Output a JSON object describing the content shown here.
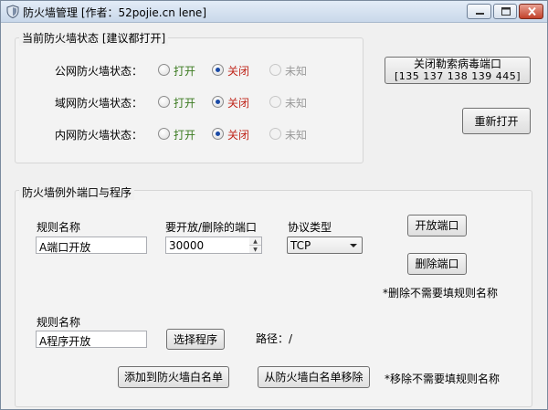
{
  "window": {
    "title": "防火墙管理 [作者：52pojie.cn lene]",
    "controls": {
      "minimize": "minimize",
      "maximize": "maximize",
      "close": "close"
    }
  },
  "status_group": {
    "label": "当前防火墙状态 [建议都打开]",
    "rows": [
      {
        "label": "公网防火墙状态：",
        "on": "打开",
        "off": "关闭",
        "unknown": "未知",
        "selected": "off"
      },
      {
        "label": "域网防火墙状态：",
        "on": "打开",
        "off": "关闭",
        "unknown": "未知",
        "selected": "off"
      },
      {
        "label": "内网防火墙状态：",
        "on": "打开",
        "off": "关闭",
        "unknown": "未知",
        "selected": "off"
      }
    ],
    "close_ransomware_button": {
      "line1": "关闭勒索病毒端口",
      "line2": "[135 137 138 139 445]"
    },
    "reopen_button": "重新打开"
  },
  "exceptions_group": {
    "label": "防火墙例外端口与程序",
    "port_rule": {
      "rule_name_label": "规则名称",
      "rule_name_value": "A端口开放",
      "port_label": "要开放/删除的端口",
      "port_value": "30000",
      "protocol_label": "协议类型",
      "protocol_value": "TCP",
      "open_port_button": "开放端口",
      "delete_port_button": "删除端口",
      "delete_note": "*删除不需要填规则名称"
    },
    "program_rule": {
      "rule_name_label": "规则名称",
      "rule_name_value": "A程序开放",
      "choose_program_button": "选择程序",
      "path_label": "路径：/",
      "add_whitelist_button": "添加到防火墙白名单",
      "remove_whitelist_button": "从防火墙白名单移除",
      "remove_note": "*移除不需要填规则名称"
    }
  }
}
